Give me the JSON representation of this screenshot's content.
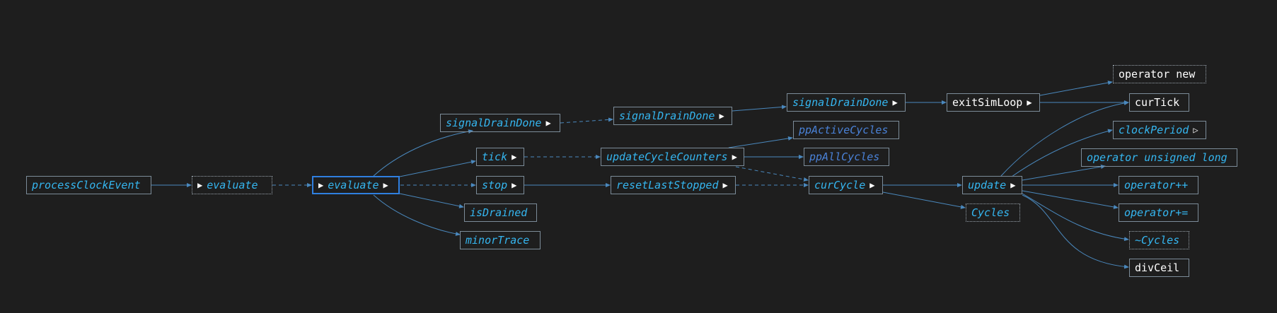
{
  "colors": {
    "background": "#1e1e1e",
    "edge": "#4a88bd",
    "node_border": "#7c8c99",
    "label_italic": "#35b6f0",
    "label_dim": "#4a82d8",
    "label_plain": "#ffffff",
    "selected_border": "#2f7fe0"
  },
  "nodes": {
    "processClockEvent": {
      "label": "processClockEvent"
    },
    "evaluate_ghost": {
      "label": "evaluate",
      "arrow": "▶"
    },
    "evaluate": {
      "label": "evaluate",
      "arrow": "▶",
      "arrow_right": "▶"
    },
    "signalDrainDone_1": {
      "label": "signalDrainDone",
      "arrow": "▶"
    },
    "tick": {
      "label": "tick",
      "arrow": "▶"
    },
    "stop": {
      "label": "stop",
      "arrow": "▶"
    },
    "isDrained": {
      "label": "isDrained"
    },
    "minorTrace": {
      "label": "minorTrace"
    },
    "signalDrainDone_2": {
      "label": "signalDrainDone",
      "arrow": "▶"
    },
    "updateCycleCounters": {
      "label": "updateCycleCounters",
      "arrow": "▶"
    },
    "resetLastStopped": {
      "label": "resetLastStopped",
      "arrow": "▶"
    },
    "signalDrainDone_3": {
      "label": "signalDrainDone",
      "arrow": "▶"
    },
    "ppActiveCycles": {
      "label": "ppActiveCycles"
    },
    "ppAllCycles": {
      "label": "ppAllCycles"
    },
    "curCycle": {
      "label": "curCycle",
      "arrow": "▶"
    },
    "exitSimLoop": {
      "label": "exitSimLoop",
      "arrow": "▶"
    },
    "update": {
      "label": "update",
      "arrow": "▶"
    },
    "Cycles": {
      "label": "Cycles"
    },
    "operator_new": {
      "label": "operator new"
    },
    "curTick": {
      "label": "curTick"
    },
    "clockPeriod": {
      "label": "clockPeriod",
      "arrow": "▷"
    },
    "operator_unsigned_long": {
      "label": "operator unsigned long"
    },
    "operator_pp": {
      "label": "operator++"
    },
    "operator_pe": {
      "label": "operator+="
    },
    "destructor_Cycles": {
      "label": "~Cycles"
    },
    "divCeil": {
      "label": "divCeil"
    }
  }
}
